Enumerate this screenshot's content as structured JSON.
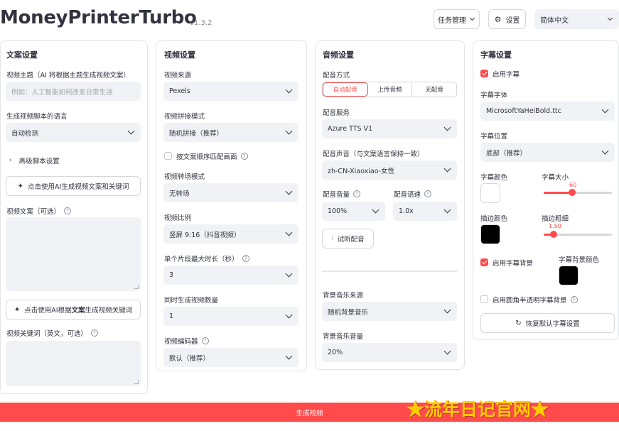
{
  "app": {
    "title": "MoneyPrinterTurbo",
    "version": "v1.3.2"
  },
  "top": {
    "task_button": "任务管理",
    "settings_button": "设置",
    "language": "简体中文"
  },
  "script_panel": {
    "title": "文案设置",
    "subject_label": "视频主题（AI 将根据主题生成视频文案）",
    "subject_placeholder": "例如：人工智能如何改变日常生活",
    "language_label": "生成视频脚本的语言",
    "language_value": "自动检测",
    "advanced_label": "高级脚本设置",
    "gen_script_button": "点击使用AI生成视频文案和关键词",
    "script_label": "视频文案（可选）",
    "gen_keywords_button_prefix": "点击使用AI根据",
    "gen_keywords_button_bold": "文案",
    "gen_keywords_button_suffix": "生成视频关键词",
    "keywords_label": "视频关键词（英文，可选）"
  },
  "video_panel": {
    "title": "视频设置",
    "source_label": "视频来源",
    "source_value": "Pexels",
    "concat_label": "视频拼接模式",
    "concat_value": "随机拼接（推荐）",
    "match_order_label": "按文案顺序匹配画面",
    "transition_label": "视频转场模式",
    "transition_value": "无转场",
    "ratio_label": "视频比例",
    "ratio_value": "竖屏 9:16（抖音视频）",
    "max_clip_label": "单个片段最大时长（秒）",
    "max_clip_value": "3",
    "count_label": "同时生成视频数量",
    "count_value": "1",
    "codec_label": "视频编码器",
    "codec_value": "默认（推荐）"
  },
  "audio_panel": {
    "title": "音频设置",
    "mode_label": "配音方式",
    "modes": [
      "自动配音",
      "上传音频",
      "无配音"
    ],
    "service_label": "配音服务",
    "service_value": "Azure TTS V1",
    "voice_label": "配音声音（与文案语言保持一致）",
    "voice_value": "zh-CN-Xiaoxiao-女性",
    "volume_label": "配音音量",
    "volume_value": "100%",
    "rate_label": "配音语速",
    "rate_value": "1.0x",
    "preview_button": "试听配音",
    "bgm_source_label": "背景音乐来源",
    "bgm_source_value": "随机背景音乐",
    "bgm_volume_label": "背景音乐音量",
    "bgm_volume_value": "20%"
  },
  "subtitle_panel": {
    "title": "字幕设置",
    "enable_label": "启用字幕",
    "font_label": "字幕字体",
    "font_value": "MicrosoftYaHeiBold.ttc",
    "position_label": "字幕位置",
    "position_value": "底部（推荐）",
    "color_label": "字幕颜色",
    "color_value": "#ffffff",
    "size_label": "字幕大小",
    "size_value": "60",
    "size_fraction": 0.42,
    "stroke_color_label": "描边颜色",
    "stroke_color_value": "#000000",
    "stroke_width_label": "描边粗细",
    "stroke_width_value": "1.50",
    "stroke_width_fraction": 0.15,
    "bg_enable_label": "启用字幕背景",
    "bg_color_label": "字幕背景颜色",
    "bg_color_value": "#000000",
    "rounded_bg_label": "启用圆角半透明字幕背景",
    "reset_button": "恢复默认字幕设置"
  },
  "generate_button": "生成视频",
  "watermark": "★流年日记官网★",
  "colors": {
    "accent": "#ff4b4b",
    "field_bg": "#f0f2f6"
  }
}
